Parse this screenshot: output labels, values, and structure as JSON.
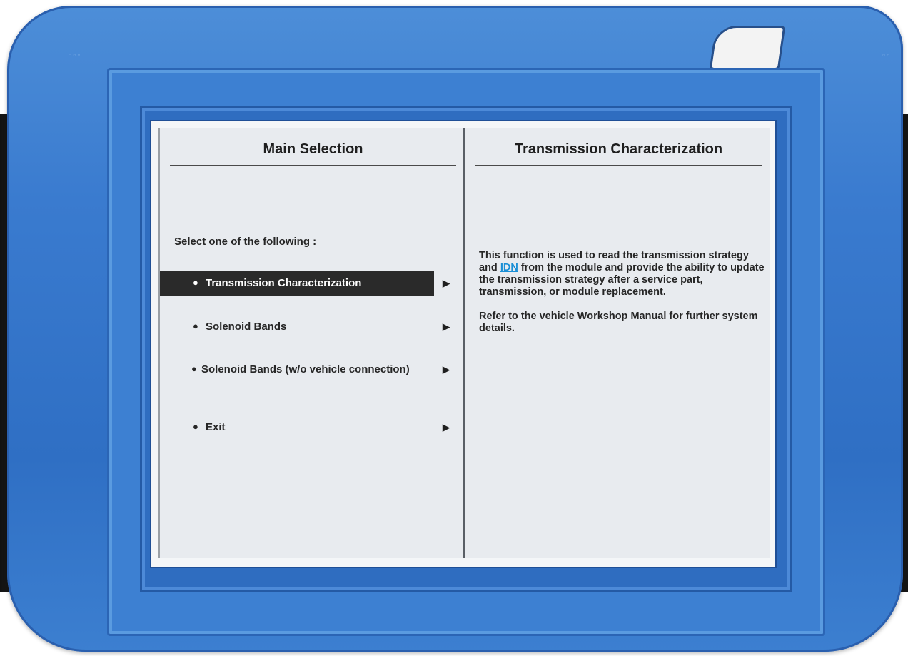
{
  "left_pane": {
    "title": "Main Selection",
    "prompt": "Select one of the following :",
    "items": [
      {
        "label": "Transmission Characterization",
        "selected": true
      },
      {
        "label": "Solenoid Bands",
        "selected": false
      },
      {
        "label": "Solenoid Bands (w/o vehicle connection)",
        "selected": false
      },
      {
        "label": "Exit",
        "selected": false
      }
    ],
    "bullet": "●",
    "arrow": "▶"
  },
  "right_pane": {
    "title": "Transmission Characterization",
    "desc_part1": "This function is used to read the transmission strategy and ",
    "desc_link": "IDN",
    "desc_part2": " from the module and provide the ability to update the transmission strategy after a service part, transmission, or module replacement.",
    "desc_2": "Refer to the vehicle Workshop Manual for further system details."
  },
  "colors": {
    "device_blue": "#3a7bcf",
    "selection_bg": "#2a2a2a",
    "link": "#1a8fd6"
  }
}
